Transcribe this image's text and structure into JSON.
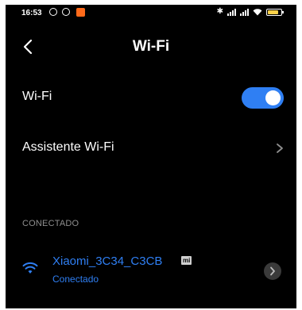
{
  "status_bar": {
    "time": "16:53",
    "left_icons": [
      "gear-icon",
      "alarm-icon",
      "app-notification-icon"
    ],
    "right_icons": [
      "bluetooth-icon",
      "signal-icon",
      "signal-icon",
      "wifi-icon",
      "battery-icon"
    ],
    "accent_app_color": "#ff6a1a",
    "battery_color": "#ffd24a"
  },
  "header": {
    "title": "Wi-Fi",
    "back_icon": "chevron-left-icon"
  },
  "wifi_toggle": {
    "label": "Wi-Fi",
    "state": "on",
    "color": "#2f7ff3"
  },
  "assistant": {
    "label": "Assistente Wi-Fi",
    "icon": "chevron-right-icon"
  },
  "connected_section": {
    "header": "CONECTADO",
    "network": {
      "name": "Xiaomi_3C34_C3CB",
      "badge": "mi",
      "status": "Conectado",
      "icon": "wifi-icon",
      "detail_icon": "chevron-right-icon",
      "color": "#2f7ff3"
    }
  },
  "colors": {
    "background": "#000000",
    "text": "#ffffff",
    "section_header": "#8f8f8f",
    "accent": "#2f7ff3"
  }
}
